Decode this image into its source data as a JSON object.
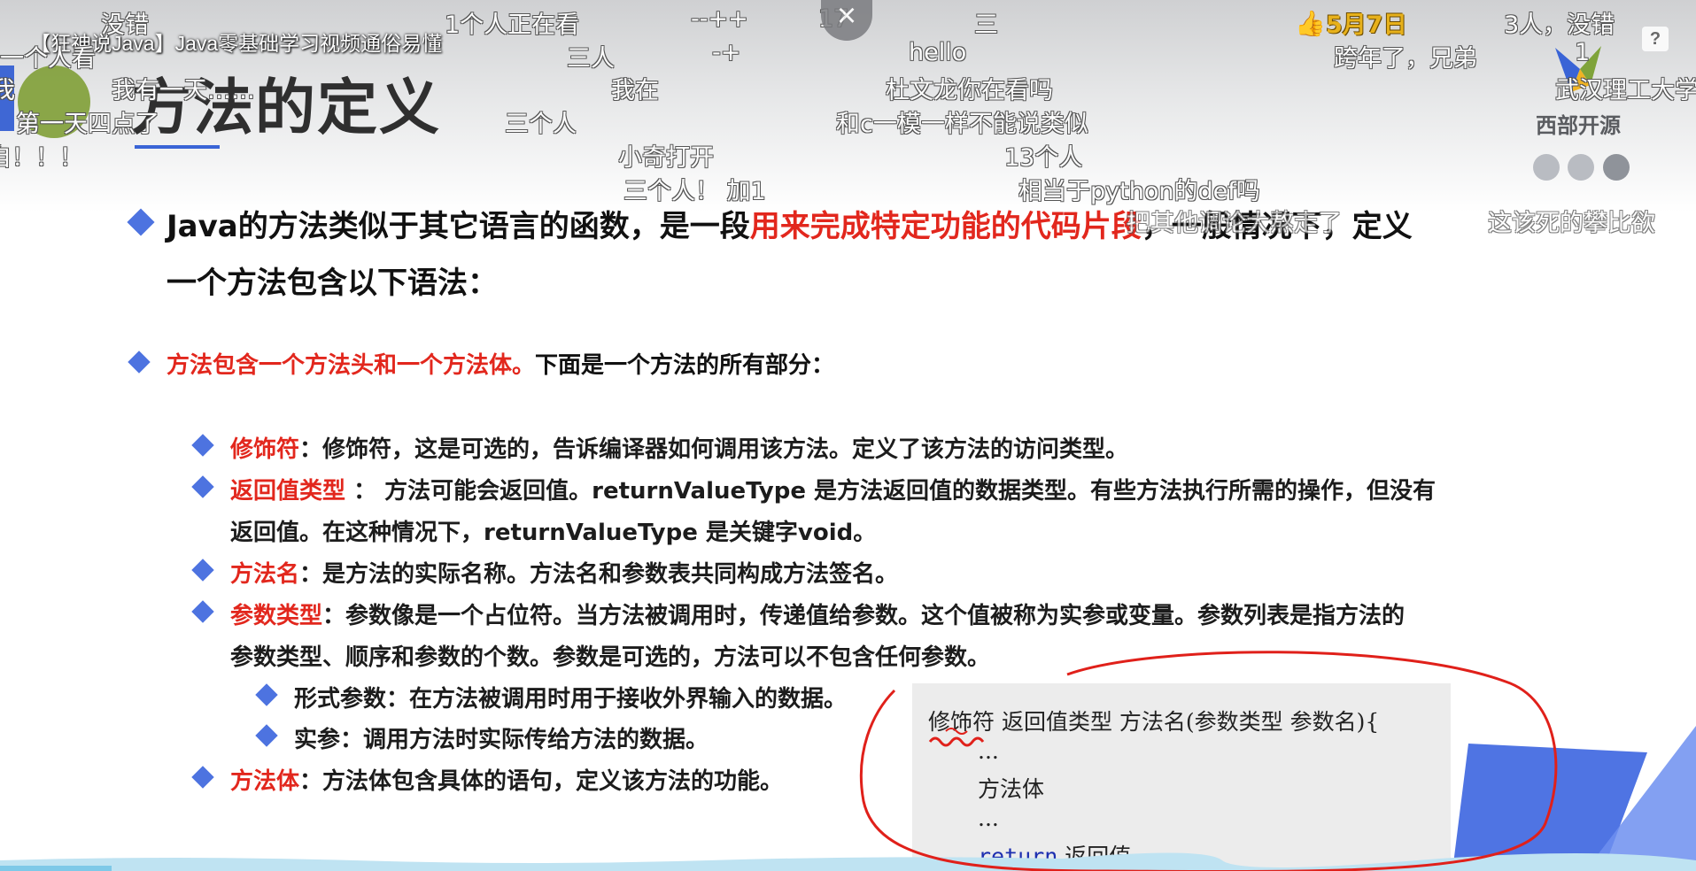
{
  "video": {
    "title": "【狂神说Java】Java零基础学习视频通俗易懂"
  },
  "slide": {
    "heading": "方法的定义",
    "logo_text": "西部开源",
    "intro_pre": "Java的方法类似于其它语言的函数，是一段",
    "intro_highlight": "用来完成特定功能的代码片段",
    "intro_post": "，一般情况下，定义",
    "intro_line2": "一个方法包含以下语法：",
    "structure_highlight": "方法包含一个方法头和一个方法体。",
    "structure_rest": "下面是一个方法的所有部分：",
    "items": [
      {
        "name": "修饰符",
        "text": "：修饰符，这是可选的，告诉编译器如何调用该方法。定义了该方法的访问类型。"
      },
      {
        "name": "返回值类型",
        "text": " ： 方法可能会返回值。returnValueType 是方法返回值的数据类型。有些方法执行所需的操作，但没有",
        "text2": "返回值。在这种情况下，returnValueType 是关键字void。"
      },
      {
        "name": "方法名",
        "text": "：是方法的实际名称。方法名和参数表共同构成方法签名。"
      },
      {
        "name": "参数类型",
        "text": "：参数像是一个占位符。当方法被调用时，传递值给参数。这个值被称为实参或变量。参数列表是指方法的",
        "text2": "参数类型、顺序和参数的个数。参数是可选的，方法可以不包含任何参数。"
      },
      {
        "name": "方法体",
        "text": "：方法体包含具体的语句，定义该方法的功能。"
      }
    ],
    "sub_items": [
      "形式参数：在方法被调用时用于接收外界输入的数据。",
      "实参：调用方法时实际传给方法的数据。"
    ],
    "code": {
      "line1": "修饰符 返回值类型 方法名(参数类型 参数名){",
      "line2": "...",
      "line3": "方法体",
      "line4": "...",
      "line5_kw": "return",
      "line5_rest": " 返回值;"
    }
  },
  "danmaku": [
    "没错",
    "1个人正在看",
    "--++",
    "17",
    "三",
    "5月7日",
    "3人，没错",
    "一个人看",
    "三人",
    "-+",
    "hello",
    "跨年了，兄弟",
    "1",
    "我有一天……",
    "我在",
    "杜文龙你在看吗",
    "武汉理工大学",
    "第一天四点了",
    "三个人",
    "和c一模一样不能说类似",
    "我",
    "小奇打开",
    "13个人",
    "自！！！",
    "三个人！ 加1",
    "相当于python的def吗",
    "把其他调论大熬走了",
    "这该死的攀比欲"
  ],
  "colors": {
    "accent_blue": "#4d73e0",
    "highlight_red": "#e2271d",
    "annotation_red": "#e0201a"
  },
  "icons": {
    "close": "close-icon",
    "help": "help-icon",
    "like": "thumbs-up-icon"
  }
}
